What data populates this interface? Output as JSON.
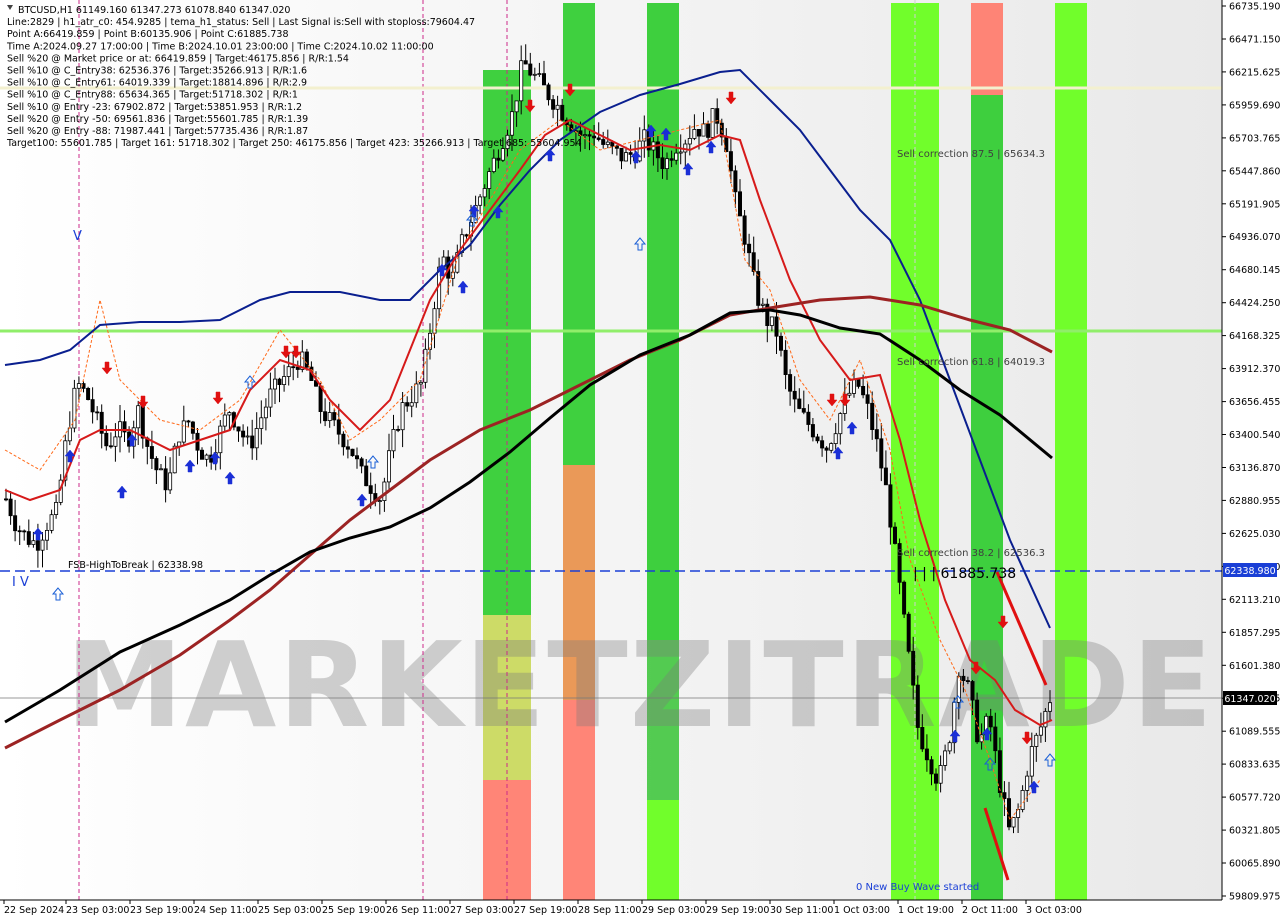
{
  "header": {
    "lines": [
      "BTCUSD,H1  61149.160 61347.273 61078.840 61347.020",
      "Line:2829 | h1_atr_c0: 454.9285 | tema_h1_status: Sell | Last Signal is:Sell with stoploss:79604.47",
      "Point A:66419.859 | Point B:60135.906 | Point C:61885.738",
      "Time A:2024.09.27 17:00:00 | Time B:2024.10.01 23:00:00 | Time C:2024.10.02 11:00:00",
      "Sell %20 @ Market price or at: 66419.859 | Target:46175.856 | R/R:1.54",
      "Sell %10 @ C_Entry38: 62536.376 | Target:35266.913 | R/R:1.6",
      "Sell %10 @ C_Entry61: 64019.339 | Target:18814.896 | R/R:2.9",
      "Sell %10 @ C_Entry88: 65634.365 | Target:51718.302 | R/R:1",
      "Sell %10 @ Entry -23: 67902.872 | Target:53851.953 | R/R:1.2",
      "Sell %20 @ Entry -50: 69561.836 | Target:55601.785 | R/R:1.39",
      "Sell %20 @ Entry -88: 71987.441 | Target:57735.436 | R/R:1.87",
      "Target100: 55601.785 | Target 161: 51718.302 | Target 250: 46175.856 | Target 423: 35266.913 | Target 685: 55604.954"
    ]
  },
  "watermark": "MARKETZITRADE",
  "annotations": {
    "corr875": "Sell correction 87.5 | 65634.3",
    "corr618": "Sell correction 61.8 | 64019.3",
    "corr382": "Sell correction 38.2 | 62536.3",
    "fsb": "FSB-HighToBreak | 62338.98",
    "pointc": "| | | 61885.738",
    "newbuy": "0 New Buy Wave started",
    "wave_iv": "I V",
    "wave_v": "V"
  },
  "price_tags": {
    "fsb": "62338.980",
    "current": "61347.020"
  },
  "colors": {
    "green": "#2fcc2f",
    "lime": "#66ff1a",
    "salmon": "#ff7b6b",
    "orange": "#e8904a",
    "blue_ma": "#0a1f8f",
    "red_ma": "#d61a1a",
    "maroon_ma": "#9c2323",
    "black_ma": "#000000",
    "fsb_line": "#1a3fd6",
    "level_line": "#90ee6a"
  },
  "chart_data": {
    "type": "candlestick",
    "symbol": "BTCUSD",
    "timeframe": "H1",
    "ylim": [
      59809.975,
      66735.19
    ],
    "y_ticks": [
      "66735.190",
      "66471.150",
      "66215.625",
      "65959.690",
      "65703.765",
      "65447.860",
      "65191.905",
      "64936.070",
      "64680.145",
      "64424.250",
      "64168.325",
      "63912.370",
      "63656.455",
      "63400.540",
      "63136.870",
      "62880.955",
      "62625.030",
      "62369.110",
      "62113.210",
      "61857.295",
      "61601.380",
      "61345.465",
      "61089.555",
      "60833.635",
      "60577.720",
      "60321.805",
      "60065.890",
      "59809.975"
    ],
    "x_ticks": [
      "22 Sep 2024",
      "23 Sep 03:00",
      "23 Sep 19:00",
      "24 Sep 11:00",
      "25 Sep 03:00",
      "25 Sep 19:00",
      "26 Sep 11:00",
      "27 Sep 03:00",
      "27 Sep 19:00",
      "28 Sep 11:00",
      "29 Sep 03:00",
      "29 Sep 19:00",
      "30 Sep 11:00",
      "1 Oct 03:00",
      "1 Oct 19:00",
      "2 Oct 11:00",
      "3 Oct 03:00"
    ],
    "close_path": [
      62900,
      62700,
      62600,
      62550,
      62700,
      62800,
      63400,
      63800,
      63700,
      63500,
      63300,
      63450,
      63350,
      63600,
      63300,
      63100,
      63000,
      63400,
      63500,
      63300,
      63200,
      63400,
      63600,
      63450,
      63300,
      63500,
      63700,
      63800,
      63900,
      64000,
      63850,
      63600,
      63500,
      63400,
      63300,
      63100,
      63000,
      62900,
      63300,
      63600,
      63700,
      63800,
      64300,
      64800,
      64600,
      64900,
      65100,
      65300,
      65500,
      65700,
      65900,
      66300,
      66200,
      66100,
      66000,
      65900,
      65800,
      65700,
      65750,
      65650,
      65600,
      65550,
      65600,
      65700,
      65600,
      65500,
      65650,
      65700,
      65800,
      65750,
      65900,
      65700,
      65200,
      64900,
      64500,
      64300,
      64200,
      63800,
      63600,
      63500,
      63400,
      63300,
      63500,
      63700,
      63800,
      63600,
      63300,
      62900,
      62300,
      61700,
      61100,
      60900,
      60700,
      61000,
      61600,
      61400,
      61000,
      61200,
      60700,
      60300,
      60500,
      60900,
      61100,
      61347
    ]
  }
}
